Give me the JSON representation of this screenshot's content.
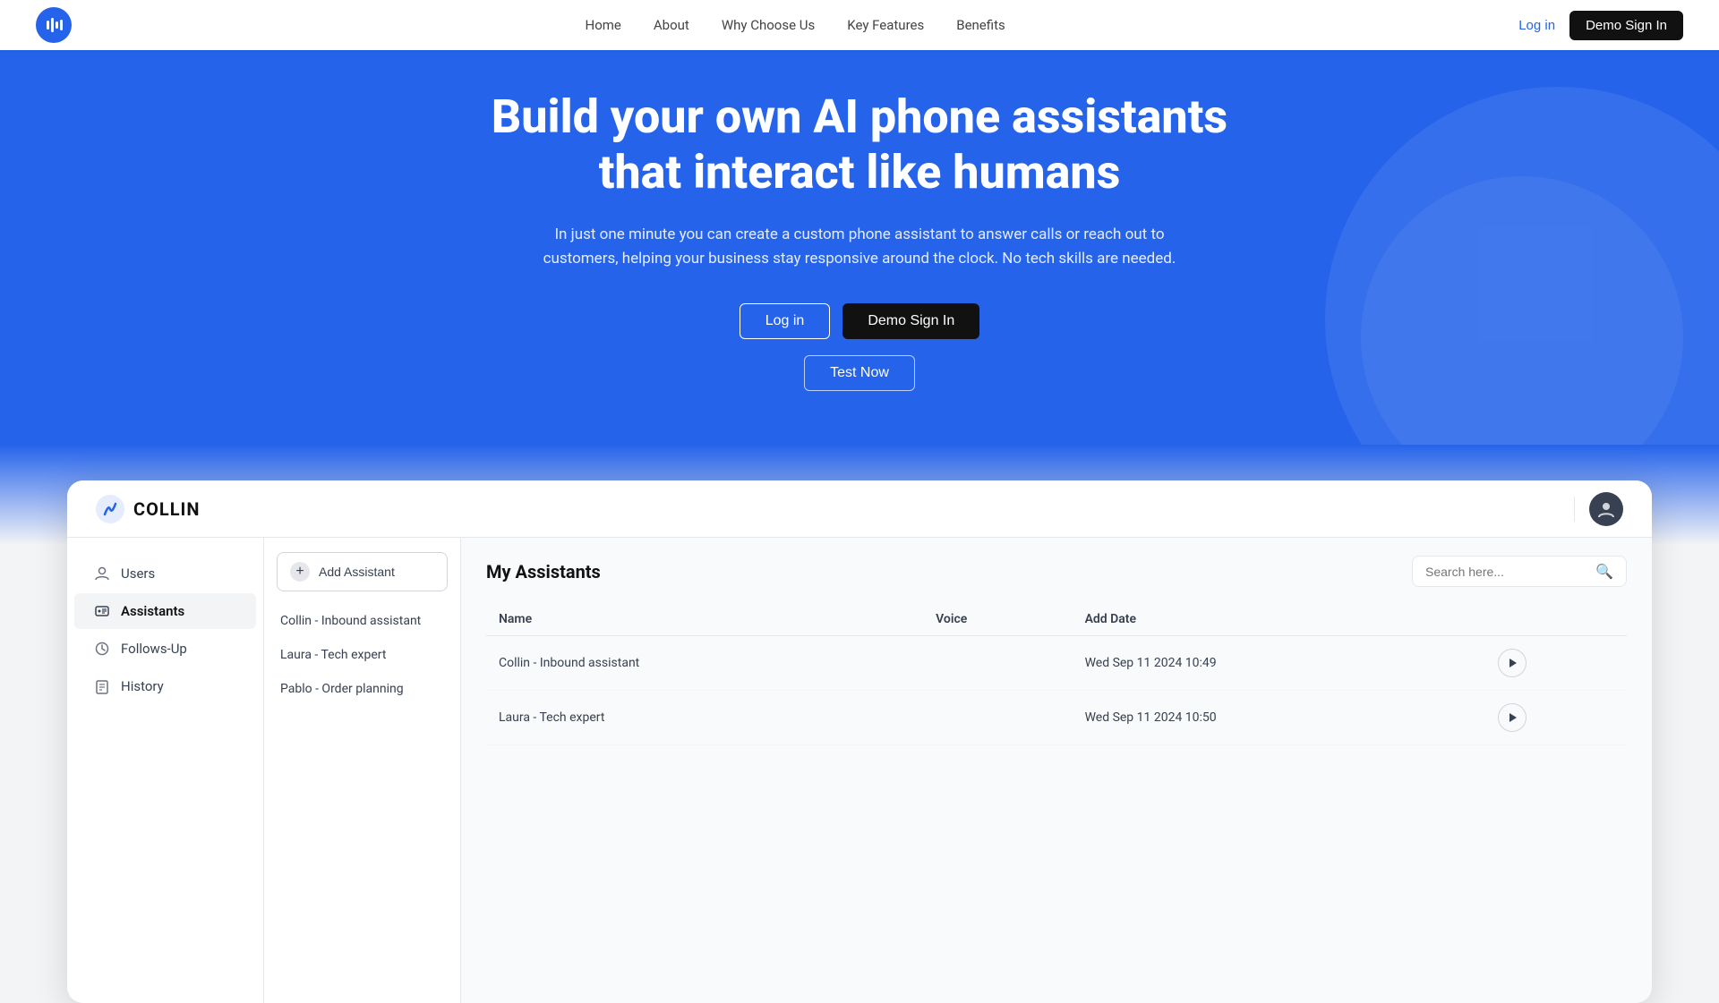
{
  "nav": {
    "logo_symbol": "▐▌",
    "links": [
      "Home",
      "About",
      "Why Choose Us",
      "Key Features",
      "Benefits"
    ],
    "login_label": "Log in",
    "demo_label": "Demo Sign In"
  },
  "hero": {
    "headline": "Build your own AI phone assistants that interact like humans",
    "subtext": "In just one minute you can create a custom phone assistant to answer calls or reach out to customers, helping your business stay responsive around the clock. No tech skills are needed.",
    "btn_login": "Log in",
    "btn_demo": "Demo Sign In",
    "btn_test": "Test Now"
  },
  "app": {
    "logo_text": "COLLIN",
    "sidebar": {
      "items": [
        {
          "label": "Users",
          "icon": "user-icon"
        },
        {
          "label": "Assistants",
          "icon": "assistants-icon",
          "active": true
        },
        {
          "label": "Follows-Up",
          "icon": "followup-icon"
        },
        {
          "label": "History",
          "icon": "history-icon"
        }
      ]
    },
    "middle_panel": {
      "add_btn_label": "Add Assistant",
      "assistants": [
        {
          "name": "Collin - Inbound assistant"
        },
        {
          "name": "Laura - Tech expert"
        },
        {
          "name": "Pablo - Order planning"
        }
      ]
    },
    "main_panel": {
      "title": "My Assistants",
      "search_placeholder": "Search here...",
      "table": {
        "headers": [
          "Name",
          "Voice",
          "Add Date"
        ],
        "rows": [
          {
            "name": "Collin - Inbound assistant",
            "voice": "",
            "date": "Wed Sep 11 2024  10:49"
          },
          {
            "name": "Laura - Tech expert",
            "voice": "",
            "date": "Wed Sep 11 2024  10:50"
          }
        ]
      }
    }
  }
}
